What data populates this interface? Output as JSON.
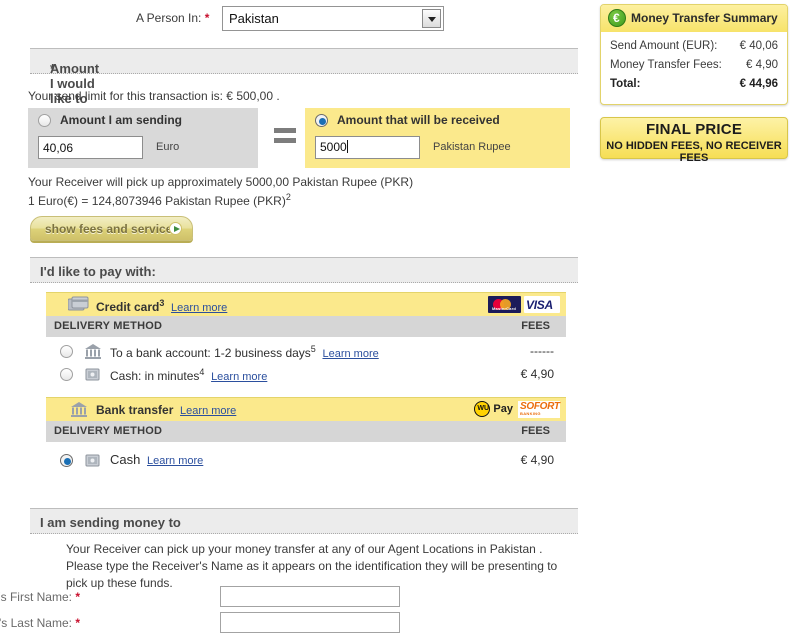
{
  "country_row": {
    "label": "A Person In:",
    "required_mark": "*",
    "selected": "Pakistan"
  },
  "send_section": {
    "header": "Amount I would like to send",
    "required_mark": "*",
    "limit_text": "Your send limit for this transaction is: € 500,00 .",
    "sending_box": {
      "title": "Amount I am sending",
      "value": "40,06",
      "currency": "Euro",
      "selected": false
    },
    "equals_sign": "=",
    "receiving_box": {
      "title": "Amount that will be received",
      "value": "5000",
      "currency": "Pakistan Rupee",
      "selected": true
    },
    "pickup_text": "Your Receiver will pick up approximately 5000,00 Pakistan Rupee (PKR)",
    "rate_prefix": "1 Euro(€) = 124,8073946 Pakistan Rupee (PKR)",
    "rate_footnote": "2",
    "fees_button": "show fees and services"
  },
  "pay_section": {
    "header": "I'd like to pay with:",
    "learn_more": "Learn more",
    "delivery_method_header": "DELIVERY METHOD",
    "fees_header": "FEES",
    "methods": [
      {
        "title": "Credit card",
        "footnote": "3",
        "icon": "credit-cards-icon",
        "logos": [
          "mastercard",
          "visa"
        ],
        "rows": [
          {
            "icon": "bank-icon",
            "text": "To a bank account: 1-2 business days",
            "footnote": "5",
            "fee": "------",
            "selected": false
          },
          {
            "icon": "cash-icon",
            "text": "Cash: in minutes",
            "footnote": "4",
            "fee": "€ 4,90",
            "selected": false
          }
        ]
      },
      {
        "title": "Bank transfer",
        "footnote": "",
        "icon": "bank-icon",
        "logos": [
          "wu-pay",
          "sofort-banking"
        ],
        "rows": [
          {
            "icon": "cash-icon",
            "text": "Cash",
            "footnote": "",
            "fee": "€ 4,90",
            "selected": true
          }
        ]
      }
    ]
  },
  "receiver_section": {
    "header": "I am sending money to",
    "intro": "Your Receiver can pick up your money transfer at any of our Agent Locations in Pakistan . Please type the Receiver's Name as it appears on the identification they will be presenting to pick up these funds.",
    "fields": [
      {
        "label": "Receiver's First Name:",
        "required_mark": "*",
        "value": ""
      },
      {
        "label": "Receiver's Last Name:",
        "required_mark": "*",
        "value": ""
      }
    ]
  },
  "summary": {
    "title": "Money Transfer Summary",
    "icon": "euro-coin-icon",
    "rows": [
      {
        "label": "Send Amount (EUR):",
        "value": "€ 40,06"
      },
      {
        "label": "Money Transfer Fees:",
        "value": "€ 4,90"
      },
      {
        "label": "Total:",
        "value": "€ 44,96"
      }
    ],
    "final_price_line1": "FINAL PRICE",
    "final_price_line2": "NO HIDDEN FEES, NO RECEIVER FEES"
  },
  "logo_text": {
    "mastercard": "MasterCard",
    "visa": "VISA",
    "wu": "WU",
    "pay": "Pay",
    "sofort": "SOFORT",
    "banking": "BANKING"
  },
  "colors": {
    "highlight_yellow": "#fbe98c",
    "panel_gray": "#d9d9d9",
    "section_gray": "#ececec",
    "required_red": "#c8102e",
    "link_blue": "#2b4f9e",
    "radio_blue": "#1a6fb5"
  }
}
